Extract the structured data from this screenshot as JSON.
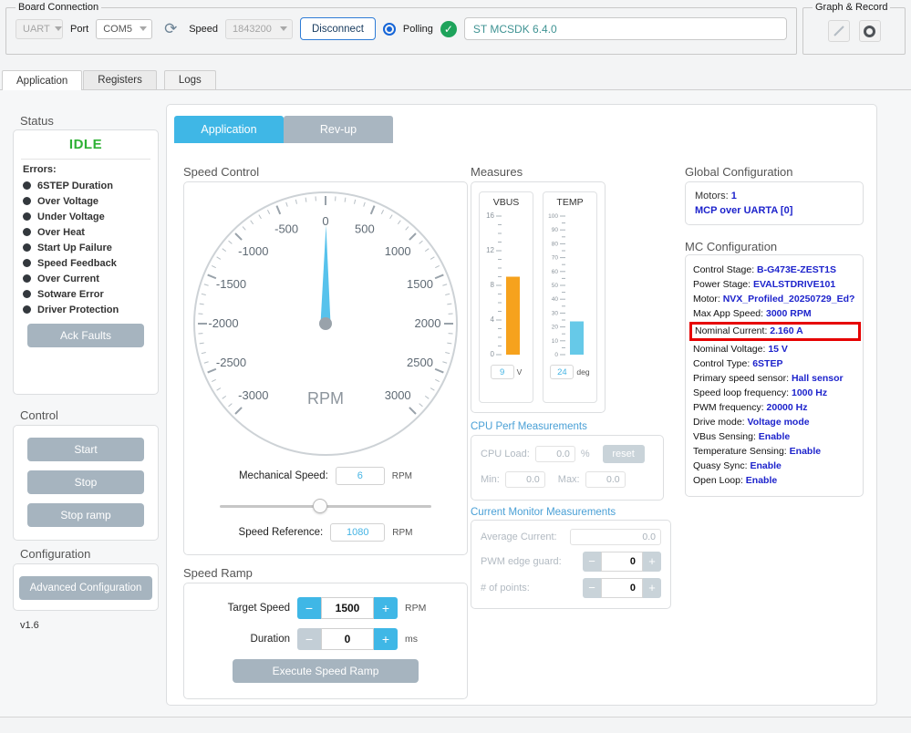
{
  "colors": {
    "accent_cyan": "#3fb7e6",
    "button_gray": "#a6b4bf",
    "value_blue": "#1d23cc",
    "idle_green": "#2eb135",
    "highlight_red": "#e60000",
    "vbus_bar": "#f6a21d",
    "temp_bar": "#66c9e8"
  },
  "icons": {
    "refresh": "⟳",
    "check": "✓"
  },
  "spinner": {
    "minus": "−",
    "plus": "+"
  },
  "board_connection": {
    "title": "Board Connection",
    "uart_value": "UART",
    "port_label": "Port",
    "port_value": "COM5",
    "speed_label": "Speed",
    "speed_value": "1843200",
    "disconnect_label": "Disconnect",
    "polling_label": "Polling",
    "polling_checked": true,
    "firmware_value": "ST MCSDK 6.4.0"
  },
  "graph_record": {
    "title": "Graph & Record"
  },
  "main_tabs": [
    {
      "label": "Application",
      "active": true
    },
    {
      "label": "Registers",
      "active": false
    },
    {
      "label": "Logs",
      "active": false
    }
  ],
  "sidebar": {
    "status": {
      "title": "Status",
      "state": "IDLE",
      "errors_label": "Errors:",
      "errors": [
        "6STEP Duration",
        "Over Voltage",
        "Under Voltage",
        "Over Heat",
        "Start Up Failure",
        "Speed Feedback",
        "Over Current",
        "Sotware Error",
        "Driver Protection"
      ],
      "ack_button": "Ack Faults"
    },
    "control": {
      "title": "Control",
      "buttons": [
        "Start",
        "Stop",
        "Stop ramp"
      ]
    },
    "configuration": {
      "title": "Configuration",
      "button": "Advanced Configuration"
    },
    "version": "v1.6"
  },
  "inner_tabs": [
    {
      "label": "Application",
      "active": true
    },
    {
      "label": "Rev-up",
      "active": false
    }
  ],
  "speed_control": {
    "title": "Speed Control",
    "gauge": {
      "unit": "RPM",
      "min": -3000,
      "max": 3000,
      "major_step": 500,
      "minor_step": 100,
      "value": 6
    },
    "mechanical_speed_label": "Mechanical Speed:",
    "mechanical_speed_value": "6",
    "mechanical_speed_unit": "RPM",
    "speed_reference_label": "Speed Reference:",
    "speed_reference_value": "1080",
    "speed_reference_unit": "RPM"
  },
  "speed_ramp": {
    "title": "Speed Ramp",
    "target_speed_label": "Target Speed",
    "target_speed_value": "1500",
    "target_speed_unit": "RPM",
    "duration_label": "Duration",
    "duration_value": "0",
    "duration_unit": "ms",
    "execute_button": "Execute Speed Ramp"
  },
  "measures": {
    "title": "Measures",
    "vbus": {
      "label": "VBUS",
      "min": 0,
      "max": 16,
      "major_step": 4,
      "minor_step": 1,
      "value": 9,
      "display_value": "9",
      "unit": "V",
      "color": "#f6a21d"
    },
    "temp": {
      "label": "TEMP",
      "min": 0,
      "max": 100,
      "major_step": 10,
      "minor_step": 5,
      "value": 24,
      "display_value": "24",
      "unit": "deg",
      "color": "#66c9e8"
    }
  },
  "cpu_perf": {
    "title": "CPU Perf Measurements",
    "cpu_load_label": "CPU Load:",
    "cpu_load_value": "0.0",
    "cpu_load_unit": "%",
    "reset_button": "reset",
    "min_label": "Min:",
    "min_value": "0.0",
    "max_label": "Max:",
    "max_value": "0.0"
  },
  "current_monitor": {
    "title": "Current Monitor Measurements",
    "average_current_label": "Average Current:",
    "average_current_value": "0.0",
    "pwm_edge_guard_label": "PWM edge guard:",
    "pwm_edge_guard_value": "0",
    "points_label": "# of points:",
    "points_value": "0"
  },
  "global_config": {
    "title": "Global Configuration",
    "motors_label": "Motors:",
    "motors_value": "1",
    "mcp_link": "MCP over UARTA [0]"
  },
  "mc_config": {
    "title": "MC Configuration",
    "items": [
      {
        "label": "Control Stage:",
        "value": "B-G473E-ZEST1S"
      },
      {
        "label": "Power Stage:",
        "value": "EVALSTDRIVE101"
      },
      {
        "label": "Motor:",
        "value": "NVX_Profiled_20250729_Ed?"
      },
      {
        "label": "Max App Speed:",
        "value": "3000 RPM"
      },
      {
        "label": "Nominal Current:",
        "value": "2.160 A",
        "highlighted": true
      },
      {
        "label": "Nominal Voltage:",
        "value": "15 V"
      },
      {
        "label": "Control Type:",
        "value": "6STEP"
      },
      {
        "label": "Primary speed sensor:",
        "value": "Hall sensor"
      },
      {
        "label": "Speed loop frequency:",
        "value": "1000 Hz"
      },
      {
        "label": "PWM frequency:",
        "value": "20000 Hz"
      },
      {
        "label": "Drive mode:",
        "value": "Voltage mode"
      },
      {
        "label": "VBus Sensing:",
        "value": "Enable"
      },
      {
        "label": "Temperature Sensing:",
        "value": "Enable"
      },
      {
        "label": "Quasy Sync:",
        "value": "Enable"
      },
      {
        "label": "Open Loop:",
        "value": "Enable"
      }
    ]
  }
}
